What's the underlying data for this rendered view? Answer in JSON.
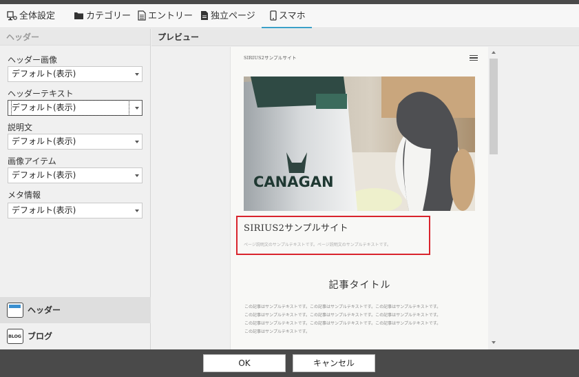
{
  "tabs": [
    {
      "label": "全体設定",
      "icon": "monitor-settings-icon"
    },
    {
      "label": "カテゴリー",
      "icon": "folder-icon"
    },
    {
      "label": "エントリー",
      "icon": "document-icon"
    },
    {
      "label": "独立ページ",
      "icon": "page-icon"
    },
    {
      "label": "スマホ",
      "icon": "smartphone-icon",
      "active": true
    }
  ],
  "left": {
    "section_title": "ヘッダー",
    "fields": [
      {
        "label": "ヘッダー画像",
        "value": "デフォルト(表示)"
      },
      {
        "label": "ヘッダーテキスト",
        "value": "デフォルト(表示)"
      },
      {
        "label": "説明文",
        "value": "デフォルト(表示)"
      },
      {
        "label": "画像アイテム",
        "value": "デフォルト(表示)"
      },
      {
        "label": "メタ情報",
        "value": "デフォルト(表示)"
      }
    ],
    "nav": [
      {
        "label": "ヘッダー",
        "icon": "header-layout-icon",
        "active": true
      },
      {
        "label": "ブログ",
        "icon": "blog-icon",
        "icon_text": "BLOG"
      }
    ]
  },
  "preview": {
    "title": "プレビュー",
    "site_name_small": "SIRIUS2サンプルサイト",
    "hero_text": "CANAGAN",
    "site_title": "SIRIUS2サンプルサイト",
    "site_description": "ページ説明文のサンプルテキストです。ページ説明文のサンプルテキストです。",
    "article_title": "記事タイトル",
    "article_lines": [
      "この記事はサンプルテキストです。この記事はサンプルテキストです。この記事はサンプルテキストです。",
      "この記事はサンプルテキストです。この記事はサンプルテキストです。この記事はサンプルテキストです。",
      "この記事はサンプルテキストです。この記事はサンプルテキストです。この記事はサンプルテキストです。",
      "この記事はサンプルテキストです。"
    ],
    "highlight_color": "#d9232c"
  },
  "footer": {
    "ok_label": "OK",
    "cancel_label": "キャンセル"
  }
}
